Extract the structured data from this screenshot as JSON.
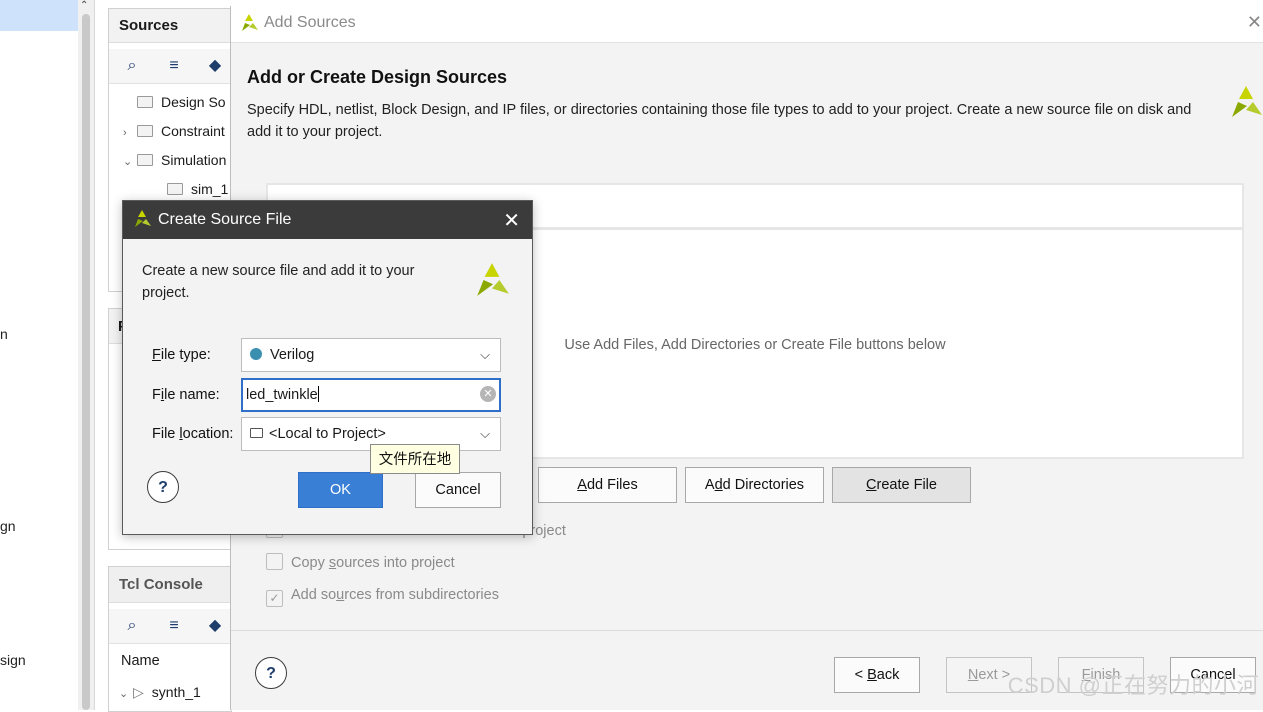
{
  "left_pane": {
    "fragments": [
      "n",
      "gn",
      "sign"
    ]
  },
  "sources_panel": {
    "title": "Sources",
    "tree": [
      {
        "label": "Design So",
        "expander": ""
      },
      {
        "label": "Constraint",
        "expander": "›"
      },
      {
        "label": "Simulation",
        "expander": "⌄"
      },
      {
        "label": "sim_1",
        "expander": ""
      }
    ]
  },
  "properties_panel": {
    "title_fragment": "P"
  },
  "tcl_console": {
    "title": "Tcl Console",
    "column_header": "Name",
    "rows": [
      {
        "label": "synth_1"
      }
    ]
  },
  "add_sources": {
    "window_title": "Add Sources",
    "heading": "Add or Create Design Sources",
    "description": "Specify HDL, netlist, Block Design, and IP files, or directories containing those file types to add to your project. Create a new source file on disk and add it to your project.",
    "empty_hint": "Use Add Files, Add Directories or Create File buttons below",
    "buttons": {
      "add_files": {
        "mnemonic": "A",
        "rest": "dd Files"
      },
      "add_directories": {
        "pre": "A",
        "mnemonic": "d",
        "rest": "d Directories"
      },
      "create_file": {
        "mnemonic": "C",
        "rest": "reate File"
      }
    },
    "options": [
      {
        "label": "Scan and add RTL include files into project",
        "checked": false
      },
      {
        "label_pre": "Copy ",
        "label_mn": "s",
        "label_post": "ources into project",
        "checked": false
      },
      {
        "label_pre": "Add so",
        "label_mn": "u",
        "label_post": "rces from subdirectories",
        "checked": true
      }
    ],
    "footer": {
      "back": {
        "pre": "< ",
        "mnemonic": "B",
        "rest": "ack"
      },
      "next": {
        "mnemonic": "N",
        "rest": "ext >"
      },
      "finish": {
        "mnemonic": "F",
        "rest": "inish"
      },
      "cancel": "Cancel",
      "help": "?"
    }
  },
  "create_source_file": {
    "title": "Create Source File",
    "description": "Create a new source file and add it to your project.",
    "file_type": {
      "label_mn": "F",
      "label_rest": "ile type:",
      "value": "Verilog"
    },
    "file_name": {
      "label_pre": "F",
      "label_mn": "i",
      "label_rest": "le name:",
      "value": "led_twinkle"
    },
    "file_location": {
      "label_pre": "File ",
      "label_mn": "l",
      "label_rest": "ocation:",
      "value": "<Local to Project>"
    },
    "tooltip": "文件所在地",
    "ok": "OK",
    "cancel": "Cancel",
    "help": "?"
  },
  "watermark": "CSDN @正在努力的小河",
  "colors": {
    "accent": "#3a7fd6",
    "vivado_logo": "#8aa800",
    "title_bar": "#3b3b3b"
  }
}
